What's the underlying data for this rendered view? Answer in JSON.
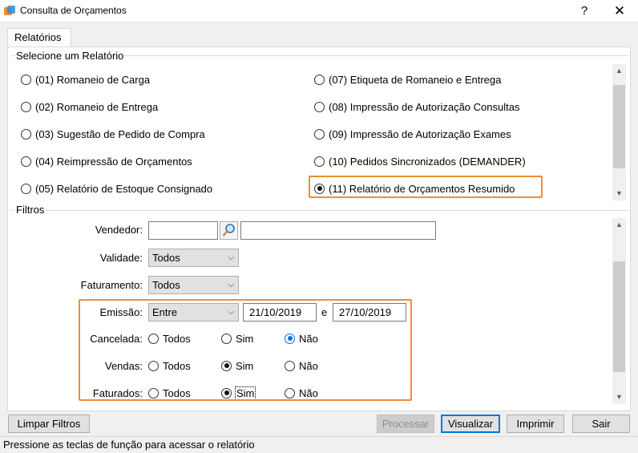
{
  "window": {
    "title": "Consulta de Orçamentos",
    "help": "?",
    "close": "✕"
  },
  "tab": {
    "label": "Relatórios"
  },
  "reports": {
    "group_title": "Selecione um Relatório",
    "left": [
      "(01) Romaneio de Carga",
      "(02) Romaneio de Entrega",
      "(03) Sugestão de Pedido de Compra",
      "(04) Reimpressão de Orçamentos",
      "(05) Relatório de Estoque Consignado"
    ],
    "right": [
      "(07) Etiqueta de Romaneio e Entrega",
      "(08) Impressão de Autorização Consultas",
      "(09) Impressão de Autorização Exames",
      "(10) Pedidos Sincronizados (DEMANDER)",
      "(11) Relatório de Orçamentos Resumido"
    ],
    "selected": "(11) Relatório de Orçamentos Resumido"
  },
  "filters": {
    "group_title": "Filtros",
    "vendedor": {
      "label": "Vendedor:",
      "code": "",
      "name": ""
    },
    "validade": {
      "label": "Validade:",
      "value": "Todos"
    },
    "faturamento": {
      "label": "Faturamento:",
      "value": "Todos"
    },
    "emissao": {
      "label": "Emissão:",
      "mode": "Entre",
      "from": "21/10/2019",
      "and": "e",
      "to": "27/10/2019"
    },
    "cancelada": {
      "label": "Cancelada:",
      "options": [
        "Todos",
        "Sim",
        "Não"
      ],
      "selected": "Não"
    },
    "vendas": {
      "label": "Vendas:",
      "options": [
        "Todos",
        "Sim",
        "Não"
      ],
      "selected": "Sim"
    },
    "faturados": {
      "label": "Faturados:",
      "options": [
        "Todos",
        "Sim",
        "Não"
      ],
      "selected": "Sim"
    }
  },
  "buttons": {
    "limpar": "Limpar Filtros",
    "processar": "Processar",
    "visualizar": "Visualizar",
    "imprimir": "Imprimir",
    "sair": "Sair"
  },
  "status": {
    "text": "Pressione as teclas de função para acessar o relatório"
  },
  "colors": {
    "highlight": "#f28c32",
    "focus": "#0078d7",
    "radio_focus": "#0a6fd6"
  }
}
